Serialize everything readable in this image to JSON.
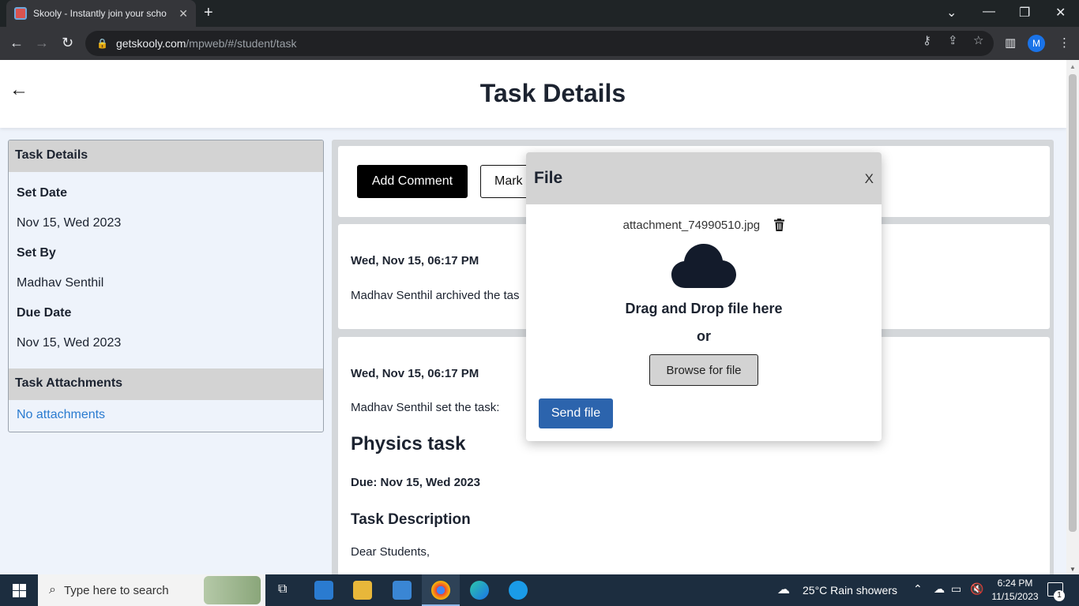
{
  "browser": {
    "tab_title": "Skooly - Instantly join your scho",
    "url_host": "getskooly.com",
    "url_path": "/mpweb/#/student/task",
    "profile_initial": "M"
  },
  "page": {
    "title": "Task Details"
  },
  "left_panel": {
    "header": "Task Details",
    "set_date_label": "Set Date",
    "set_date_value": "Nov 15, Wed 2023",
    "set_by_label": "Set By",
    "set_by_value": "Madhav Senthil",
    "due_date_label": "Due Date",
    "due_date_value": "Nov 15, Wed 2023",
    "attachments_header": "Task Attachments",
    "attachments_value": "No attachments"
  },
  "actions": {
    "add_comment": "Add Comment",
    "mark": "Mark"
  },
  "feed": [
    {
      "timestamp": "Wed, Nov 15, 06:17 PM",
      "text": "Madhav Senthil archived the tas"
    },
    {
      "timestamp": "Wed, Nov 15, 06:17 PM",
      "text": "Madhav Senthil set the task:",
      "task_title": "Physics task",
      "due": "Due: Nov 15, Wed 2023",
      "desc_heading": "Task Description",
      "desc_body": "Dear Students,"
    }
  ],
  "modal": {
    "title": "File",
    "close": "X",
    "file_name": "attachment_74990510.jpg",
    "drag_text": "Drag and Drop file here",
    "or_text": "or",
    "browse_label": "Browse for file",
    "send_label": "Send file"
  },
  "taskbar": {
    "search_placeholder": "Type here to search",
    "weather": "25°C  Rain showers",
    "time": "6:24 PM",
    "date": "11/15/2023",
    "notification_count": "1"
  },
  "colors": {
    "accent_blue": "#2c64ad",
    "link_blue": "#2a7bd0",
    "header_gray": "#d3d3d3"
  }
}
